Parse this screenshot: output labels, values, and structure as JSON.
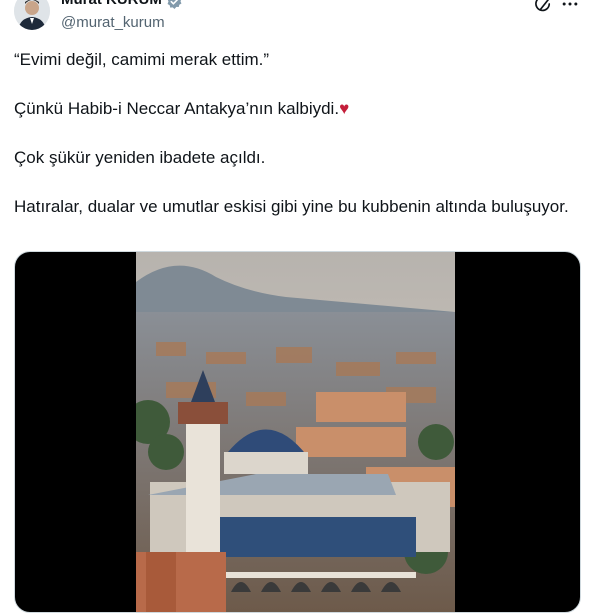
{
  "author": {
    "name": "Murat KURUM",
    "handle": "@murat_kurum",
    "verified_icon": "verified-badge-icon"
  },
  "actions": {
    "grok_icon": "grok-icon",
    "more_icon": "more-icon"
  },
  "tweet": {
    "p1": "“Evimi değil, camimi merak ettim.”",
    "p2": "Çünkü Habib-i Neccar Antakya’nın kalbiydi.",
    "p2_emoji": "♥",
    "p3": "Çok şükür yeniden ibadete açıldı.",
    "p4": "Hatıralar, dualar ve umutlar eskisi gibi yine bu kubbenin altında buluşuyor."
  },
  "colors": {
    "text": "#0f1419",
    "secondary": "#536471",
    "verified": "#829aab",
    "heart": "#c41e3a"
  }
}
